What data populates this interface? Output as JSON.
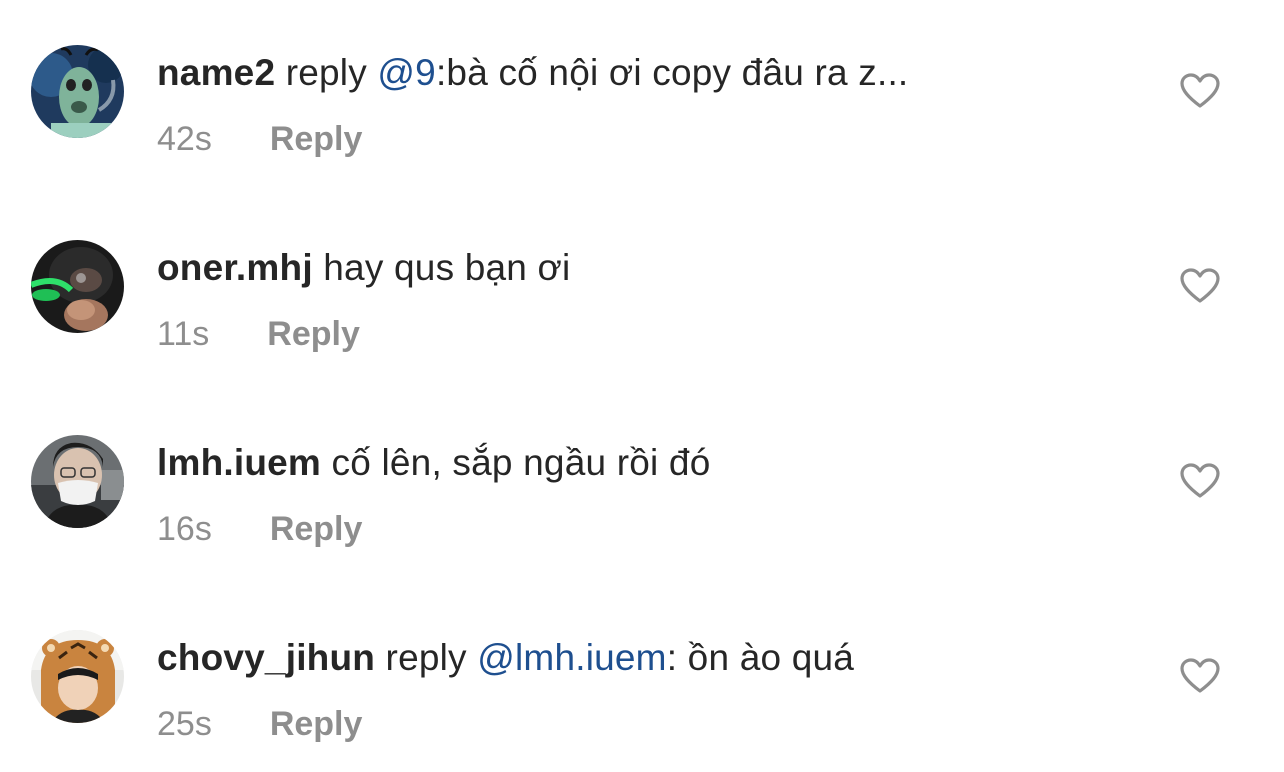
{
  "comments": [
    {
      "username": "name2",
      "mid": " reply ",
      "mention": "@9",
      "text": ":bà cố nội ơi copy đâu ra z...",
      "time": "42s",
      "reply_label": "Reply",
      "avatar_icon": "green-creature-avatar",
      "like_icon": "heart-outline-icon"
    },
    {
      "username": "oner.mhj",
      "mid": "",
      "mention": "",
      "text": " hay qus bạn ơi",
      "time": "11s",
      "reply_label": "Reply",
      "avatar_icon": "dark-photo-avatar",
      "like_icon": "heart-outline-icon"
    },
    {
      "username": "lmh.iuem",
      "mid": "",
      "mention": "",
      "text": " cố lên, sắp ngầu rồi đó",
      "time": "16s",
      "reply_label": "Reply",
      "avatar_icon": "masked-person-avatar",
      "like_icon": "heart-outline-icon"
    },
    {
      "username": "chovy_jihun",
      "mid": " reply ",
      "mention": "@lmh.iuem",
      "text": ": ồn ào quá",
      "time": "25s",
      "reply_label": "Reply",
      "avatar_icon": "tiger-hood-avatar",
      "like_icon": "heart-outline-icon"
    }
  ],
  "colors": {
    "text": "#262626",
    "secondary": "#8e8e8e",
    "mention": "#1e4f8f",
    "background": "#ffffff"
  }
}
